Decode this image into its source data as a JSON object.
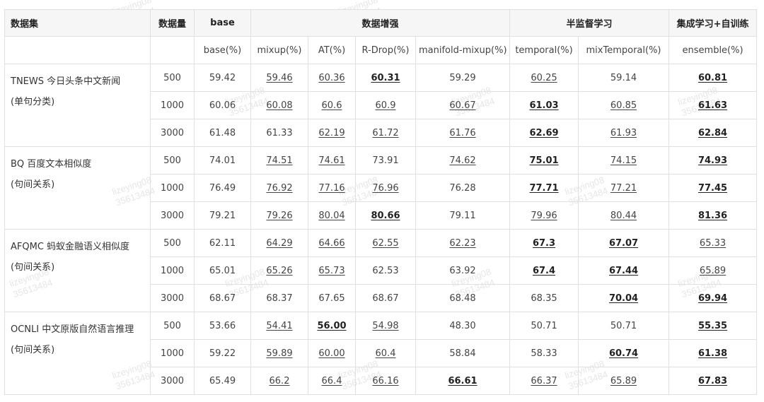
{
  "watermark": [
    "lizeying08",
    "35613484"
  ],
  "header": {
    "dataset": "数据集",
    "count": "数据量",
    "base": "base",
    "augment": "数据增强",
    "semi": "半监督学习",
    "ensemble": "集成学习+自训练"
  },
  "subheaders": [
    "base(%)",
    "mixup(%)",
    "AT(%)",
    "R-Drop(%)",
    "manifold-mixup(%)",
    "temporal(%)",
    "mixTemporal(%)",
    "ensemble(%)"
  ],
  "datasets": [
    {
      "name": "TNEWS 今日头条中文新闻",
      "type": "(单句分类)",
      "rows": [
        {
          "n": "500",
          "cells": [
            {
              "v": "59.42",
              "s": ""
            },
            {
              "v": "59.46",
              "s": "u"
            },
            {
              "v": "60.36",
              "s": "u"
            },
            {
              "v": "60.31",
              "s": "ub"
            },
            {
              "v": "59.29",
              "s": ""
            },
            {
              "v": "60.25",
              "s": "u"
            },
            {
              "v": "59.14",
              "s": ""
            },
            {
              "v": "60.81",
              "s": "ub"
            }
          ]
        },
        {
          "n": "1000",
          "cells": [
            {
              "v": "60.06",
              "s": ""
            },
            {
              "v": "60.08",
              "s": "u"
            },
            {
              "v": "60.6",
              "s": "u"
            },
            {
              "v": "60.9",
              "s": "u"
            },
            {
              "v": "60.67",
              "s": "u"
            },
            {
              "v": "61.03",
              "s": "ub"
            },
            {
              "v": "60.85",
              "s": "u"
            },
            {
              "v": "61.63",
              "s": "ub"
            }
          ]
        },
        {
          "n": "3000",
          "cells": [
            {
              "v": "61.48",
              "s": ""
            },
            {
              "v": "61.33",
              "s": ""
            },
            {
              "v": "62.19",
              "s": "u"
            },
            {
              "v": "61.72",
              "s": "u"
            },
            {
              "v": "61.76",
              "s": "u"
            },
            {
              "v": "62.69",
              "s": "ub"
            },
            {
              "v": "61.93",
              "s": "u"
            },
            {
              "v": "62.84",
              "s": "ub"
            }
          ]
        }
      ]
    },
    {
      "name": "BQ 百度文本相似度",
      "type": "(句间关系)",
      "rows": [
        {
          "n": "500",
          "cells": [
            {
              "v": "74.01",
              "s": ""
            },
            {
              "v": "74.51",
              "s": "u"
            },
            {
              "v": "74.61",
              "s": "u"
            },
            {
              "v": "73.91",
              "s": ""
            },
            {
              "v": "74.62",
              "s": "u"
            },
            {
              "v": "75.01",
              "s": "ub"
            },
            {
              "v": "74.15",
              "s": "u"
            },
            {
              "v": "74.93",
              "s": "ub"
            }
          ]
        },
        {
          "n": "1000",
          "cells": [
            {
              "v": "76.49",
              "s": ""
            },
            {
              "v": "76.92",
              "s": "u"
            },
            {
              "v": "77.16",
              "s": "u"
            },
            {
              "v": "76.96",
              "s": "u"
            },
            {
              "v": "76.28",
              "s": ""
            },
            {
              "v": "77.71",
              "s": "ub"
            },
            {
              "v": "77.21",
              "s": "u"
            },
            {
              "v": "77.45",
              "s": "ub"
            }
          ]
        },
        {
          "n": "3000",
          "cells": [
            {
              "v": "79.21",
              "s": ""
            },
            {
              "v": "79.26",
              "s": "u"
            },
            {
              "v": "80.04",
              "s": "u"
            },
            {
              "v": "80.66",
              "s": "ub"
            },
            {
              "v": "79.11",
              "s": ""
            },
            {
              "v": "79.96",
              "s": "u"
            },
            {
              "v": "80.44",
              "s": "u"
            },
            {
              "v": "81.36",
              "s": "ub"
            }
          ]
        }
      ]
    },
    {
      "name": "AFQMC 蚂蚁金融语义相似度",
      "type": "(句间关系)",
      "rows": [
        {
          "n": "500",
          "cells": [
            {
              "v": "62.11",
              "s": ""
            },
            {
              "v": "64.29",
              "s": "u"
            },
            {
              "v": "64.66",
              "s": "u"
            },
            {
              "v": "62.55",
              "s": "u"
            },
            {
              "v": "62.23",
              "s": "u"
            },
            {
              "v": "67.3",
              "s": "ub"
            },
            {
              "v": "67.07",
              "s": "ub"
            },
            {
              "v": "65.33",
              "s": "u"
            }
          ]
        },
        {
          "n": "1000",
          "cells": [
            {
              "v": "65.01",
              "s": ""
            },
            {
              "v": "65.26",
              "s": "u"
            },
            {
              "v": "65.73",
              "s": "u"
            },
            {
              "v": "62.53",
              "s": ""
            },
            {
              "v": "63.92",
              "s": ""
            },
            {
              "v": "67.4",
              "s": "ub"
            },
            {
              "v": "67.44",
              "s": "ub"
            },
            {
              "v": "65.89",
              "s": "u"
            }
          ]
        },
        {
          "n": "3000",
          "cells": [
            {
              "v": "68.67",
              "s": ""
            },
            {
              "v": "68.37",
              "s": ""
            },
            {
              "v": "67.65",
              "s": ""
            },
            {
              "v": "68.67",
              "s": ""
            },
            {
              "v": "68.48",
              "s": ""
            },
            {
              "v": "68.35",
              "s": ""
            },
            {
              "v": "70.04",
              "s": "ub"
            },
            {
              "v": "69.94",
              "s": "ub"
            }
          ]
        }
      ]
    },
    {
      "name": "OCNLI 中文原版自然语言推理",
      "type": "(句间关系)",
      "rows": [
        {
          "n": "500",
          "cells": [
            {
              "v": "53.66",
              "s": ""
            },
            {
              "v": "54.41",
              "s": "u"
            },
            {
              "v": "56.00",
              "s": "ub"
            },
            {
              "v": "54.98",
              "s": "u"
            },
            {
              "v": "48.30",
              "s": ""
            },
            {
              "v": "50.71",
              "s": ""
            },
            {
              "v": "50.71",
              "s": ""
            },
            {
              "v": "55.35",
              "s": "ub"
            }
          ]
        },
        {
          "n": "1000",
          "cells": [
            {
              "v": "59.22",
              "s": ""
            },
            {
              "v": "59.89",
              "s": "u"
            },
            {
              "v": "60.00",
              "s": "u"
            },
            {
              "v": "60.4",
              "s": "u"
            },
            {
              "v": "58.84",
              "s": ""
            },
            {
              "v": "58.33",
              "s": ""
            },
            {
              "v": "60.74",
              "s": "ub"
            },
            {
              "v": "61.38",
              "s": "ub"
            }
          ]
        },
        {
          "n": "3000",
          "cells": [
            {
              "v": "65.49",
              "s": ""
            },
            {
              "v": "66.2",
              "s": "u"
            },
            {
              "v": "66.4",
              "s": "u"
            },
            {
              "v": "66.16",
              "s": "u"
            },
            {
              "v": "66.61",
              "s": "ub"
            },
            {
              "v": "66.37",
              "s": "u"
            },
            {
              "v": "65.89",
              "s": "u"
            },
            {
              "v": "67.83",
              "s": "ub"
            }
          ]
        }
      ]
    }
  ]
}
